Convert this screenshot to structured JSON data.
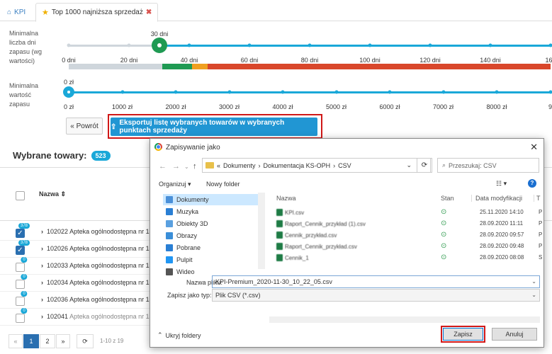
{
  "tabs": [
    {
      "icon": "home-icon",
      "label": "KPI"
    },
    {
      "icon": "star-icon",
      "label": "Top 1000 najniższa sprzedaż",
      "close": "✖"
    }
  ],
  "slider1": {
    "label": "Minimalna liczba dni zapasu (wg wartości)",
    "label_lines": [
      "Minimalna",
      "liczba dni",
      "zapasu (wg",
      "wartości)"
    ],
    "value_label": "30 dni",
    "value": 30,
    "ticks": [
      "0 dni",
      "20 dni",
      "40 dni",
      "60 dni",
      "80 dni",
      "100 dni",
      "120 dni",
      "140 dni",
      "160"
    ]
  },
  "color_bar": [
    {
      "color": "#cfd6dc",
      "from_days": 0,
      "to_days": 31
    },
    {
      "color": "#1f9a53",
      "from_days": 31,
      "to_days": 41
    },
    {
      "color": "#f0a020",
      "from_days": 41,
      "to_days": 46
    },
    {
      "color": "#d9472b",
      "from_days": 46,
      "to_days": 160
    }
  ],
  "slider2": {
    "label_lines": [
      "Minimalna",
      "wartość",
      "zapasu"
    ],
    "value_label": "0 zł",
    "value": 0,
    "ticks": [
      "0 zł",
      "1000 zł",
      "2000 zł",
      "3000 zł",
      "4000 zł",
      "5000 zł",
      "6000 zł",
      "7000 zł",
      "8000 zł",
      "9"
    ]
  },
  "actions": {
    "back_label": "« Powrót",
    "export_label": "Eksportuj listę wybranych towarów w wybranych punktach sprzedaży"
  },
  "selected": {
    "title": "Wybrane towary:",
    "count": "523"
  },
  "table": {
    "col_name": "Nazwa ⇕",
    "rows": [
      {
        "checked": true,
        "badge": "378",
        "code": "102022",
        "name": "Apteka ogólnodostępna nr 1020"
      },
      {
        "checked": true,
        "badge": "378",
        "code": "102026",
        "name": "Apteka ogólnodostępna nr 1020"
      },
      {
        "checked": false,
        "badge": "0",
        "code": "102033",
        "name": "Apteka ogólnodostępna nr 1020"
      },
      {
        "checked": false,
        "badge": "0",
        "code": "102034",
        "name": "Apteka ogólnodostępna nr 1020"
      },
      {
        "checked": false,
        "badge": "0",
        "code": "102036",
        "name": "Apteka ogólnodostępna nr 1020"
      },
      {
        "checked": false,
        "badge": "0",
        "code": "102041",
        "name": "Apteka ogólnodostępna nr 1020"
      }
    ]
  },
  "pager": {
    "first": "«",
    "p1": "1",
    "p2": "2",
    "last": "»",
    "refresh": "⟳",
    "info": "1-10 z 19"
  },
  "dialog": {
    "title": "Zapisywanie jako",
    "close": "✕",
    "path_prefix": "«",
    "path": [
      "Dokumenty",
      "Dokumentacja KS-OPH",
      "CSV"
    ],
    "search_placeholder": "Przeszukaj: CSV",
    "organize": "Organizuj ▾",
    "new_folder": "Nowy folder",
    "help": "?",
    "nav": [
      {
        "icon": "documents-icon",
        "label": "Dokumenty",
        "selected": true,
        "color": "#4a90d9"
      },
      {
        "icon": "music-icon",
        "label": "Muzyka",
        "color": "#2a7fd4"
      },
      {
        "icon": "3d-objects-icon",
        "label": "Obiekty 3D",
        "color": "#5aa0e0"
      },
      {
        "icon": "pictures-icon",
        "label": "Obrazy",
        "color": "#3a8ed8"
      },
      {
        "icon": "downloads-icon",
        "label": "Pobrane",
        "color": "#2a7fd4"
      },
      {
        "icon": "desktop-icon",
        "label": "Pulpit",
        "color": "#2196f3"
      },
      {
        "icon": "video-icon",
        "label": "Wideo",
        "color": "#555555"
      }
    ],
    "headers": {
      "name": "Nazwa",
      "status": "Stan",
      "modified": "Data modyfikacji",
      "type": "T"
    },
    "files": [
      {
        "name": "KPI.csv",
        "date": "25.11.2020 14:10",
        "type": "P"
      },
      {
        "name": "Raport_Cennik_przykład (1).csv",
        "date": "28.09.2020 11:11",
        "type": "P"
      },
      {
        "name": "Cennik_przykład.csv",
        "date": "28.09.2020 09:57",
        "type": "P"
      },
      {
        "name": "Raport_Cennik_przykład.csv",
        "date": "28.09.2020 09:48",
        "type": "P"
      },
      {
        "name": "Cennik_1",
        "date": "28.09.2020 08:08",
        "type": "S"
      }
    ],
    "filename_label": "Nazwa pliku:",
    "filename": "KPI-Premium_2020-11-30_10_22_05.csv",
    "filetype_label": "Zapisz jako typ:",
    "filetype": "Plik CSV (*.csv)",
    "hide_folders": "Ukryj foldery",
    "save": "Zapisz",
    "cancel": "Anuluj"
  }
}
